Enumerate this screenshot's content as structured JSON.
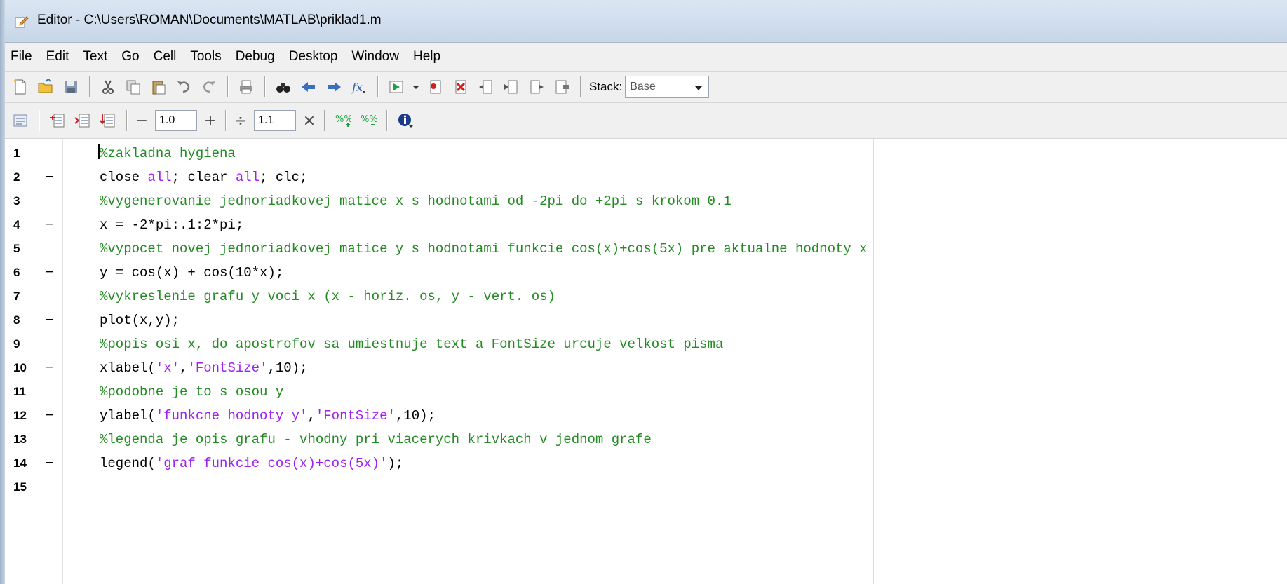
{
  "window": {
    "title": "Editor - C:\\Users\\ROMAN\\Documents\\MATLAB\\priklad1.m"
  },
  "menu": [
    "File",
    "Edit",
    "Text",
    "Go",
    "Cell",
    "Tools",
    "Debug",
    "Desktop",
    "Window",
    "Help"
  ],
  "toolbar": {
    "stack_label": "Stack:",
    "stack_value": "Base",
    "cell_minus": "−",
    "cell_value1": "1.0",
    "cell_plus": "+",
    "cell_div": "÷",
    "cell_value2": "1.1",
    "cell_times": "×"
  },
  "editor": {
    "lines": [
      {
        "num": "1",
        "dash": "",
        "code": [
          {
            "t": "%zakladna hygiena",
            "c": "comment"
          }
        ]
      },
      {
        "num": "2",
        "dash": "−",
        "code": [
          {
            "t": "close ",
            "c": "plain"
          },
          {
            "t": "all",
            "c": "str"
          },
          {
            "t": "; clear ",
            "c": "plain"
          },
          {
            "t": "all",
            "c": "str"
          },
          {
            "t": "; clc;",
            "c": "plain"
          }
        ]
      },
      {
        "num": "3",
        "dash": "",
        "code": [
          {
            "t": "%vygenerovanie jednoriadkovej matice x s hodnotami od -2pi do +2pi s krokom 0.1",
            "c": "comment"
          }
        ]
      },
      {
        "num": "4",
        "dash": "−",
        "code": [
          {
            "t": "x = -2*pi:.1:2*pi;",
            "c": "plain"
          }
        ]
      },
      {
        "num": "5",
        "dash": "",
        "code": [
          {
            "t": "%vypocet novej jednoriadkovej matice y s hodnotami funkcie cos(x)+cos(5x) pre aktualne hodnoty x",
            "c": "comment"
          }
        ]
      },
      {
        "num": "6",
        "dash": "−",
        "code": [
          {
            "t": "y = cos(x) + cos(10*x);",
            "c": "plain"
          }
        ]
      },
      {
        "num": "7",
        "dash": "",
        "code": [
          {
            "t": "%vykreslenie grafu y voci x (x - horiz. os, y - vert. os)",
            "c": "comment"
          }
        ]
      },
      {
        "num": "8",
        "dash": "−",
        "code": [
          {
            "t": "plot(x,y);",
            "c": "plain"
          }
        ]
      },
      {
        "num": "9",
        "dash": "",
        "code": [
          {
            "t": "%popis osi x, do apostrofov sa umiestnuje text a FontSize urcuje velkost pisma",
            "c": "comment"
          }
        ]
      },
      {
        "num": "10",
        "dash": "−",
        "code": [
          {
            "t": "xlabel(",
            "c": "plain"
          },
          {
            "t": "'x'",
            "c": "str"
          },
          {
            "t": ",",
            "c": "plain"
          },
          {
            "t": "'FontSize'",
            "c": "str"
          },
          {
            "t": ",10);",
            "c": "plain"
          }
        ]
      },
      {
        "num": "11",
        "dash": "",
        "code": [
          {
            "t": "%podobne je to s osou y",
            "c": "comment"
          }
        ]
      },
      {
        "num": "12",
        "dash": "−",
        "code": [
          {
            "t": "ylabel(",
            "c": "plain"
          },
          {
            "t": "'funkcne hodnoty y'",
            "c": "str"
          },
          {
            "t": ",",
            "c": "plain"
          },
          {
            "t": "'FontSize'",
            "c": "str"
          },
          {
            "t": ",10);",
            "c": "plain"
          }
        ]
      },
      {
        "num": "13",
        "dash": "",
        "code": [
          {
            "t": "%legenda je opis grafu - vhodny pri viacerych krivkach v jednom grafe",
            "c": "comment"
          }
        ]
      },
      {
        "num": "14",
        "dash": "−",
        "code": [
          {
            "t": "legend(",
            "c": "plain"
          },
          {
            "t": "'graf funkcie cos(x)+cos(5x)'",
            "c": "str"
          },
          {
            "t": ");",
            "c": "plain"
          }
        ]
      },
      {
        "num": "15",
        "dash": "",
        "code": []
      }
    ]
  },
  "colors": {
    "comment": "#228b22",
    "keyword": "#0000ff",
    "string": "#a020f0"
  }
}
